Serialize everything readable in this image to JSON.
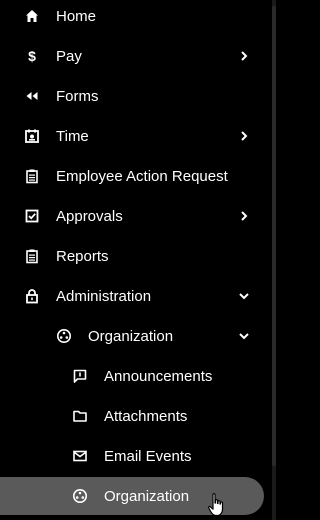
{
  "nav": {
    "items": [
      {
        "label": "Home",
        "icon": "home-icon"
      },
      {
        "label": "Pay",
        "icon": "dollar-icon",
        "chevron": "right"
      },
      {
        "label": "Forms",
        "icon": "rewind-icon"
      },
      {
        "label": "Time",
        "icon": "time-badge-icon",
        "chevron": "right"
      },
      {
        "label": "Employee Action Request",
        "icon": "clipboard-icon"
      },
      {
        "label": "Approvals",
        "icon": "checkbox-icon",
        "chevron": "right"
      },
      {
        "label": "Reports",
        "icon": "clipboard-icon"
      },
      {
        "label": "Administration",
        "icon": "lock-icon",
        "chevron": "down"
      },
      {
        "label": "Organization",
        "icon": "org-icon",
        "chevron": "down"
      },
      {
        "label": "Announcements",
        "icon": "chat-icon"
      },
      {
        "label": "Attachments",
        "icon": "folder-icon"
      },
      {
        "label": "Email Events",
        "icon": "mail-icon"
      },
      {
        "label": "Organization",
        "icon": "org-icon",
        "selected": true
      }
    ]
  },
  "colors": {
    "background": "#000000",
    "text": "#ffffff",
    "selected_background": "#5a5a5a"
  }
}
